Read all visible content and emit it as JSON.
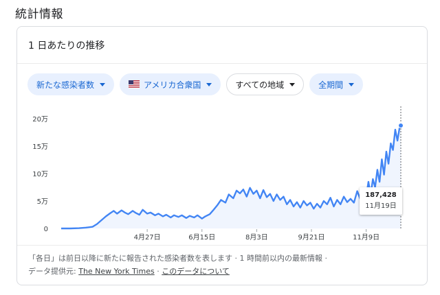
{
  "section_title": "統計情報",
  "card_title": "1 日あたりの推移",
  "chips": [
    {
      "label": "新たな感染者数",
      "style": "blue"
    },
    {
      "label": "アメリカ合衆国",
      "style": "blue",
      "icon": "us-flag-icon"
    },
    {
      "label": "すべての地域",
      "style": "white"
    },
    {
      "label": "全期間",
      "style": "blue"
    }
  ],
  "tooltip": {
    "value": "187,428",
    "date": "11月19日"
  },
  "footer": {
    "note": "「各日」は前日以降に新たに報告された感染者数を表します · 1 時間前以内の最新情報 ·",
    "source_label": "データ提供元:",
    "source_link": "The New York Times",
    "separator": "·",
    "about_link": "このデータについて"
  },
  "colors": {
    "line": "#4285f4",
    "chip_bg": "#e8f0fe",
    "chip_text": "#1967d2"
  },
  "chart_data": {
    "type": "area",
    "title": "",
    "xlabel": "",
    "ylabel": "",
    "ylim": [
      0,
      200000
    ],
    "y_ticks": [
      0,
      50000,
      100000,
      150000,
      200000
    ],
    "y_tick_labels": [
      "0",
      "5万",
      "10万",
      "15万",
      "20万"
    ],
    "x_range": [
      0,
      304
    ],
    "x_ticks": [
      77,
      126,
      175,
      224,
      273
    ],
    "x_tick_labels": [
      "4月27日",
      "6月15日",
      "8月3日",
      "9月21日",
      "11月9日"
    ],
    "x_ticks_note": "x values are days elapsed since the first data point (Feb 10)",
    "series": [
      {
        "x": [
          0,
          8,
          16,
          22,
          28,
          32,
          36,
          40,
          44,
          47,
          50,
          54,
          57,
          60,
          64,
          67,
          70,
          73,
          77,
          80,
          84,
          87,
          91,
          94,
          98,
          101,
          105,
          108,
          112,
          115,
          119,
          122,
          126,
          129,
          133,
          136,
          140,
          143,
          147,
          150,
          154,
          157,
          160,
          163,
          166,
          169,
          172,
          175,
          178,
          181,
          184,
          187,
          190,
          193,
          196,
          199,
          202,
          205,
          208,
          211,
          214,
          217,
          220,
          223,
          226,
          229,
          232,
          235,
          238,
          241,
          244,
          247,
          250,
          253,
          256,
          259,
          262,
          265,
          268,
          271,
          273,
          275,
          277,
          279,
          281,
          283,
          285,
          287,
          289,
          291,
          293,
          295,
          297,
          299,
          301,
          303,
          304
        ],
        "y": [
          0,
          0,
          500,
          1500,
          3000,
          8000,
          15000,
          22000,
          28000,
          32000,
          27000,
          33000,
          29000,
          26000,
          32000,
          28000,
          25000,
          34000,
          27000,
          29000,
          24000,
          27000,
          22000,
          25000,
          20000,
          24000,
          21000,
          24000,
          19000,
          23000,
          20000,
          24000,
          18000,
          22000,
          26000,
          33000,
          43000,
          52000,
          47000,
          62000,
          55000,
          69000,
          64000,
          71000,
          58000,
          74000,
          63000,
          69000,
          55000,
          70000,
          57000,
          63000,
          50000,
          62000,
          52000,
          58000,
          44000,
          52000,
          40000,
          48000,
          38000,
          50000,
          42000,
          47000,
          36000,
          45000,
          38000,
          50000,
          44000,
          56000,
          40000,
          52000,
          44000,
          58000,
          48000,
          54000,
          47000,
          68000,
          52000,
          73000,
          58000,
          85000,
          62000,
          90000,
          75000,
          107000,
          85000,
          126000,
          98000,
          140000,
          118000,
          155000,
          143000,
          180000,
          160000,
          185000,
          187428
        ]
      }
    ],
    "highlight_point": {
      "x": 304,
      "y": 187428
    },
    "grid": false
  }
}
